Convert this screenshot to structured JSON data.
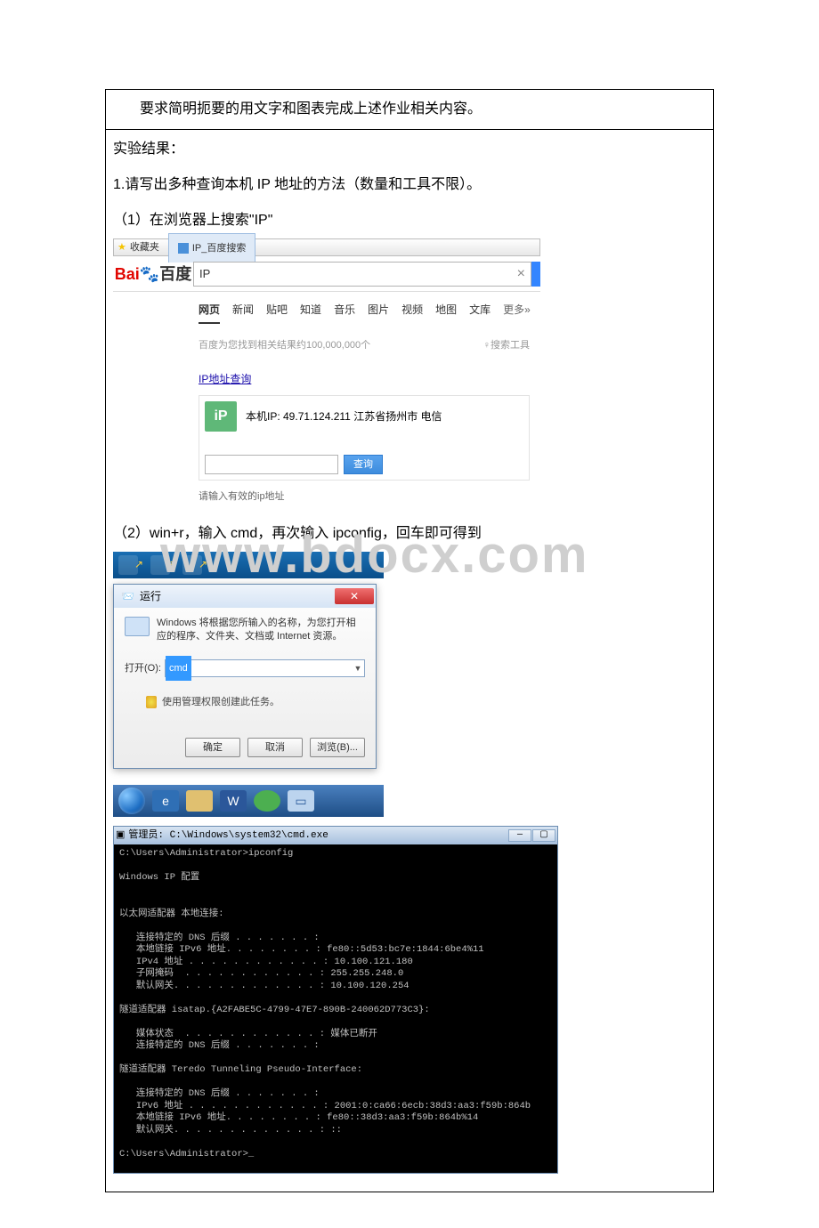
{
  "watermark": "www.bdocx.com",
  "doc": {
    "row1": "要求简明扼要的用文字和图表完成上述作业相关内容。",
    "result_label": "实验结果：",
    "q1": "1.请写出多种查询本机 IP 地址的方法（数量和工具不限）。",
    "m1": "（1）在浏览器上搜索\"IP\"",
    "m2": "（2）win+r，输入 cmd，再次输入 ipconfig，回车即可得到"
  },
  "baidu": {
    "fav": "收藏夹",
    "tab": "IP_百度搜索",
    "logo_bai": "Bai",
    "logo_du": "百度",
    "search_value": "IP",
    "nav": [
      "网页",
      "新闻",
      "贴吧",
      "知道",
      "音乐",
      "图片",
      "视频",
      "地图",
      "文库",
      "更多»"
    ],
    "result_count": "百度为您找到相关结果约100,000,000个",
    "tools": "♀搜索工具",
    "ip_query_link": "IP地址查询",
    "ip_badge": "iP",
    "my_ip_label": "本机IP: 49.71.124.211  江苏省扬州市 电信",
    "query_btn": "查询",
    "hint": "请输入有效的ip地址"
  },
  "run": {
    "title_prefix": "📨",
    "title": "运行",
    "close": "✕",
    "desc": "Windows 将根据您所输入的名称，为您打开相应的程序、文件夹、文档或 Internet 资源。",
    "open_label": "打开(O):",
    "open_value": "cmd",
    "admin": "使用管理权限创建此任务。",
    "ok": "确定",
    "cancel": "取消",
    "browse": "浏览(B)..."
  },
  "cmd": {
    "title": "管理员: C:\\Windows\\system32\\cmd.exe",
    "body": "C:\\Users\\Administrator>ipconfig\n\nWindows IP 配置\n\n\n以太网适配器 本地连接:\n\n   连接特定的 DNS 后缀 . . . . . . . :\n   本地链接 IPv6 地址. . . . . . . . : fe80::5d53:bc7e:1844:6be4%11\n   IPv4 地址 . . . . . . . . . . . . : 10.100.121.180\n   子网掩码  . . . . . . . . . . . . : 255.255.248.0\n   默认网关. . . . . . . . . . . . . : 10.100.120.254\n\n隧道适配器 isatap.{A2FABE5C-4799-47E7-890B-240062D773C3}:\n\n   媒体状态  . . . . . . . . . . . . : 媒体已断开\n   连接特定的 DNS 后缀 . . . . . . . :\n\n隧道适配器 Teredo Tunneling Pseudo-Interface:\n\n   连接特定的 DNS 后缀 . . . . . . . :\n   IPv6 地址 . . . . . . . . . . . . : 2001:0:ca66:6ecb:38d3:aa3:f59b:864b\n   本地链接 IPv6 地址. . . . . . . . : fe80::38d3:aa3:f59b:864b%14\n   默认网关. . . . . . . . . . . . . : ::\n\nC:\\Users\\Administrator>_"
  }
}
